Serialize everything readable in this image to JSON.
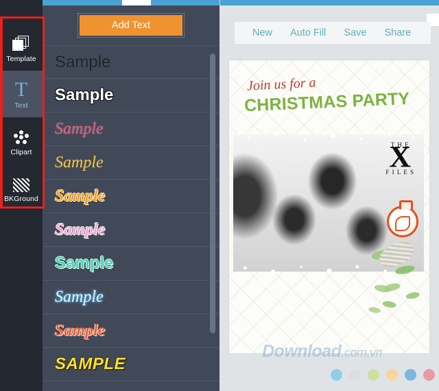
{
  "rail": {
    "items": [
      {
        "label": "Template",
        "icon": "layers-icon",
        "active": false
      },
      {
        "label": "Text",
        "icon": "text-t-icon",
        "active": true
      },
      {
        "label": "Clipart",
        "icon": "clipart-dots-icon",
        "active": false
      },
      {
        "label": "BKGround",
        "icon": "hatch-pattern-icon",
        "active": false
      }
    ],
    "highlight_color": "#e8211c"
  },
  "panel": {
    "add_text_label": "Add Text",
    "add_text_color": "#f0922f",
    "styles": [
      {
        "label": "Sample",
        "style": "s1",
        "name": "text-style-black"
      },
      {
        "label": "Sample",
        "style": "s2",
        "name": "text-style-white-outline"
      },
      {
        "label": "Sample",
        "style": "s3",
        "name": "text-style-pink-script"
      },
      {
        "label": "Sample",
        "style": "s4",
        "name": "text-style-gold-script"
      },
      {
        "label": "Sample",
        "style": "s5",
        "name": "text-style-orange-bold-script"
      },
      {
        "label": "Sample",
        "style": "s6",
        "name": "text-style-pink-bold-script"
      },
      {
        "label": "Sample",
        "style": "s7",
        "name": "text-style-mint-bold"
      },
      {
        "label": "Sample",
        "style": "s8",
        "name": "text-style-blue-glow"
      },
      {
        "label": "Sample",
        "style": "s9",
        "name": "text-style-coral-script"
      },
      {
        "label": "SAMPLE",
        "style": "s10",
        "name": "text-style-yellow-caps"
      }
    ]
  },
  "toolbar": {
    "items": [
      {
        "label": "New",
        "name": "toolbar-new"
      },
      {
        "label": "Auto Fill",
        "name": "toolbar-auto-fill"
      },
      {
        "label": "Save",
        "name": "toolbar-save"
      },
      {
        "label": "Share",
        "name": "toolbar-share"
      }
    ],
    "link_color": "#5bb4b8"
  },
  "card": {
    "script_line": "Join us for a",
    "script_color": "#c0392b",
    "headline": "CHRISTMAS PARTY",
    "headline_color": "#7cb342",
    "photo": {
      "poster_top_text": "T H E",
      "poster_big_letter": "X",
      "poster_side_text": "F I L E S"
    }
  },
  "watermark": {
    "brand": "Download",
    "suffix": ".com.vn"
  },
  "swatches": [
    {
      "color": "#8fcde8",
      "name": "swatch-light-blue"
    },
    {
      "color": "#dcdee0",
      "name": "swatch-gray"
    },
    {
      "color": "#cfdfa0",
      "name": "swatch-light-green"
    },
    {
      "color": "#f7d79a",
      "name": "swatch-light-orange"
    },
    {
      "color": "#7cb8dc",
      "name": "swatch-blue"
    },
    {
      "color": "#e89aa2",
      "name": "swatch-pink"
    }
  ]
}
